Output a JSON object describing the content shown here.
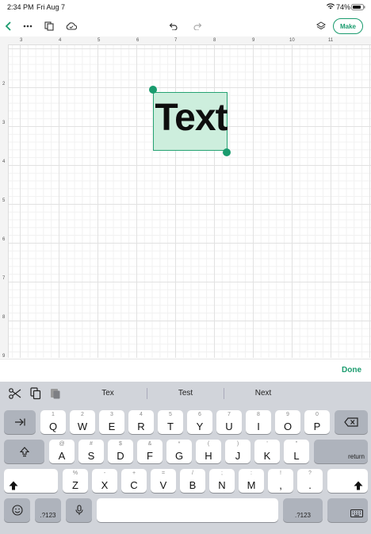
{
  "status_bar": {
    "time": "2:34 PM",
    "date": "Fri Aug 7",
    "battery": "74%",
    "wifi_icon": "wifi-icon",
    "battery_icon": "battery-charging-icon"
  },
  "toolbar": {
    "back_icon": "chevron-left-icon",
    "more_icon": "ellipsis-icon",
    "pages_icon": "copy-icon",
    "cloud_icon": "cloud-check-icon",
    "undo_icon": "undo-icon",
    "redo_icon": "redo-icon",
    "layers_icon": "layers-icon",
    "make_label": "Make",
    "accent_color": "#1a9b6e"
  },
  "canvas": {
    "ruler_top_labels": [
      "3",
      "4",
      "5",
      "6",
      "7",
      "8",
      "9",
      "10",
      "11"
    ],
    "ruler_left_labels": [
      "2",
      "3",
      "4",
      "5",
      "6",
      "7",
      "8",
      "9"
    ],
    "text_object": "Text",
    "selection_color": "#cdeedd"
  },
  "done_label": "Done",
  "keyboard": {
    "tools": [
      "scissors-icon",
      "copy-icon",
      "paste-icon"
    ],
    "suggestions": [
      "Tex",
      "Test",
      "Next"
    ],
    "row1": [
      {
        "sec": "1",
        "pri": "Q"
      },
      {
        "sec": "2",
        "pri": "W"
      },
      {
        "sec": "3",
        "pri": "E"
      },
      {
        "sec": "4",
        "pri": "R"
      },
      {
        "sec": "5",
        "pri": "T"
      },
      {
        "sec": "6",
        "pri": "Y"
      },
      {
        "sec": "7",
        "pri": "U"
      },
      {
        "sec": "8",
        "pri": "I"
      },
      {
        "sec": "9",
        "pri": "O"
      },
      {
        "sec": "0",
        "pri": "P"
      }
    ],
    "row2": [
      {
        "sec": "@",
        "pri": "A"
      },
      {
        "sec": "#",
        "pri": "S"
      },
      {
        "sec": "$",
        "pri": "D"
      },
      {
        "sec": "&",
        "pri": "F"
      },
      {
        "sec": "*",
        "pri": "G"
      },
      {
        "sec": "(",
        "pri": "H"
      },
      {
        "sec": ")",
        "pri": "J"
      },
      {
        "sec": "'",
        "pri": "K"
      },
      {
        "sec": "\"",
        "pri": "L"
      }
    ],
    "row3": [
      {
        "sec": "%",
        "pri": "Z"
      },
      {
        "sec": "-",
        "pri": "X"
      },
      {
        "sec": "+",
        "pri": "C"
      },
      {
        "sec": "=",
        "pri": "V"
      },
      {
        "sec": "/",
        "pri": "B"
      },
      {
        "sec": ";",
        "pri": "N"
      },
      {
        "sec": ":",
        "pri": "M"
      },
      {
        "sec": "!",
        "pri": ","
      },
      {
        "sec": "?",
        "pri": "."
      }
    ],
    "tab_icon": "tab-arrow-icon",
    "delete_icon": "delete-backspace-icon",
    "capslock_icon": "caps-lock-icon",
    "return_label": "return",
    "shift_icon": "shift-icon",
    "emoji_icon": "emoji-icon",
    "numbers_label": ".?123",
    "mic_icon": "microphone-icon",
    "keyboard_icon": "keyboard-hide-icon"
  }
}
